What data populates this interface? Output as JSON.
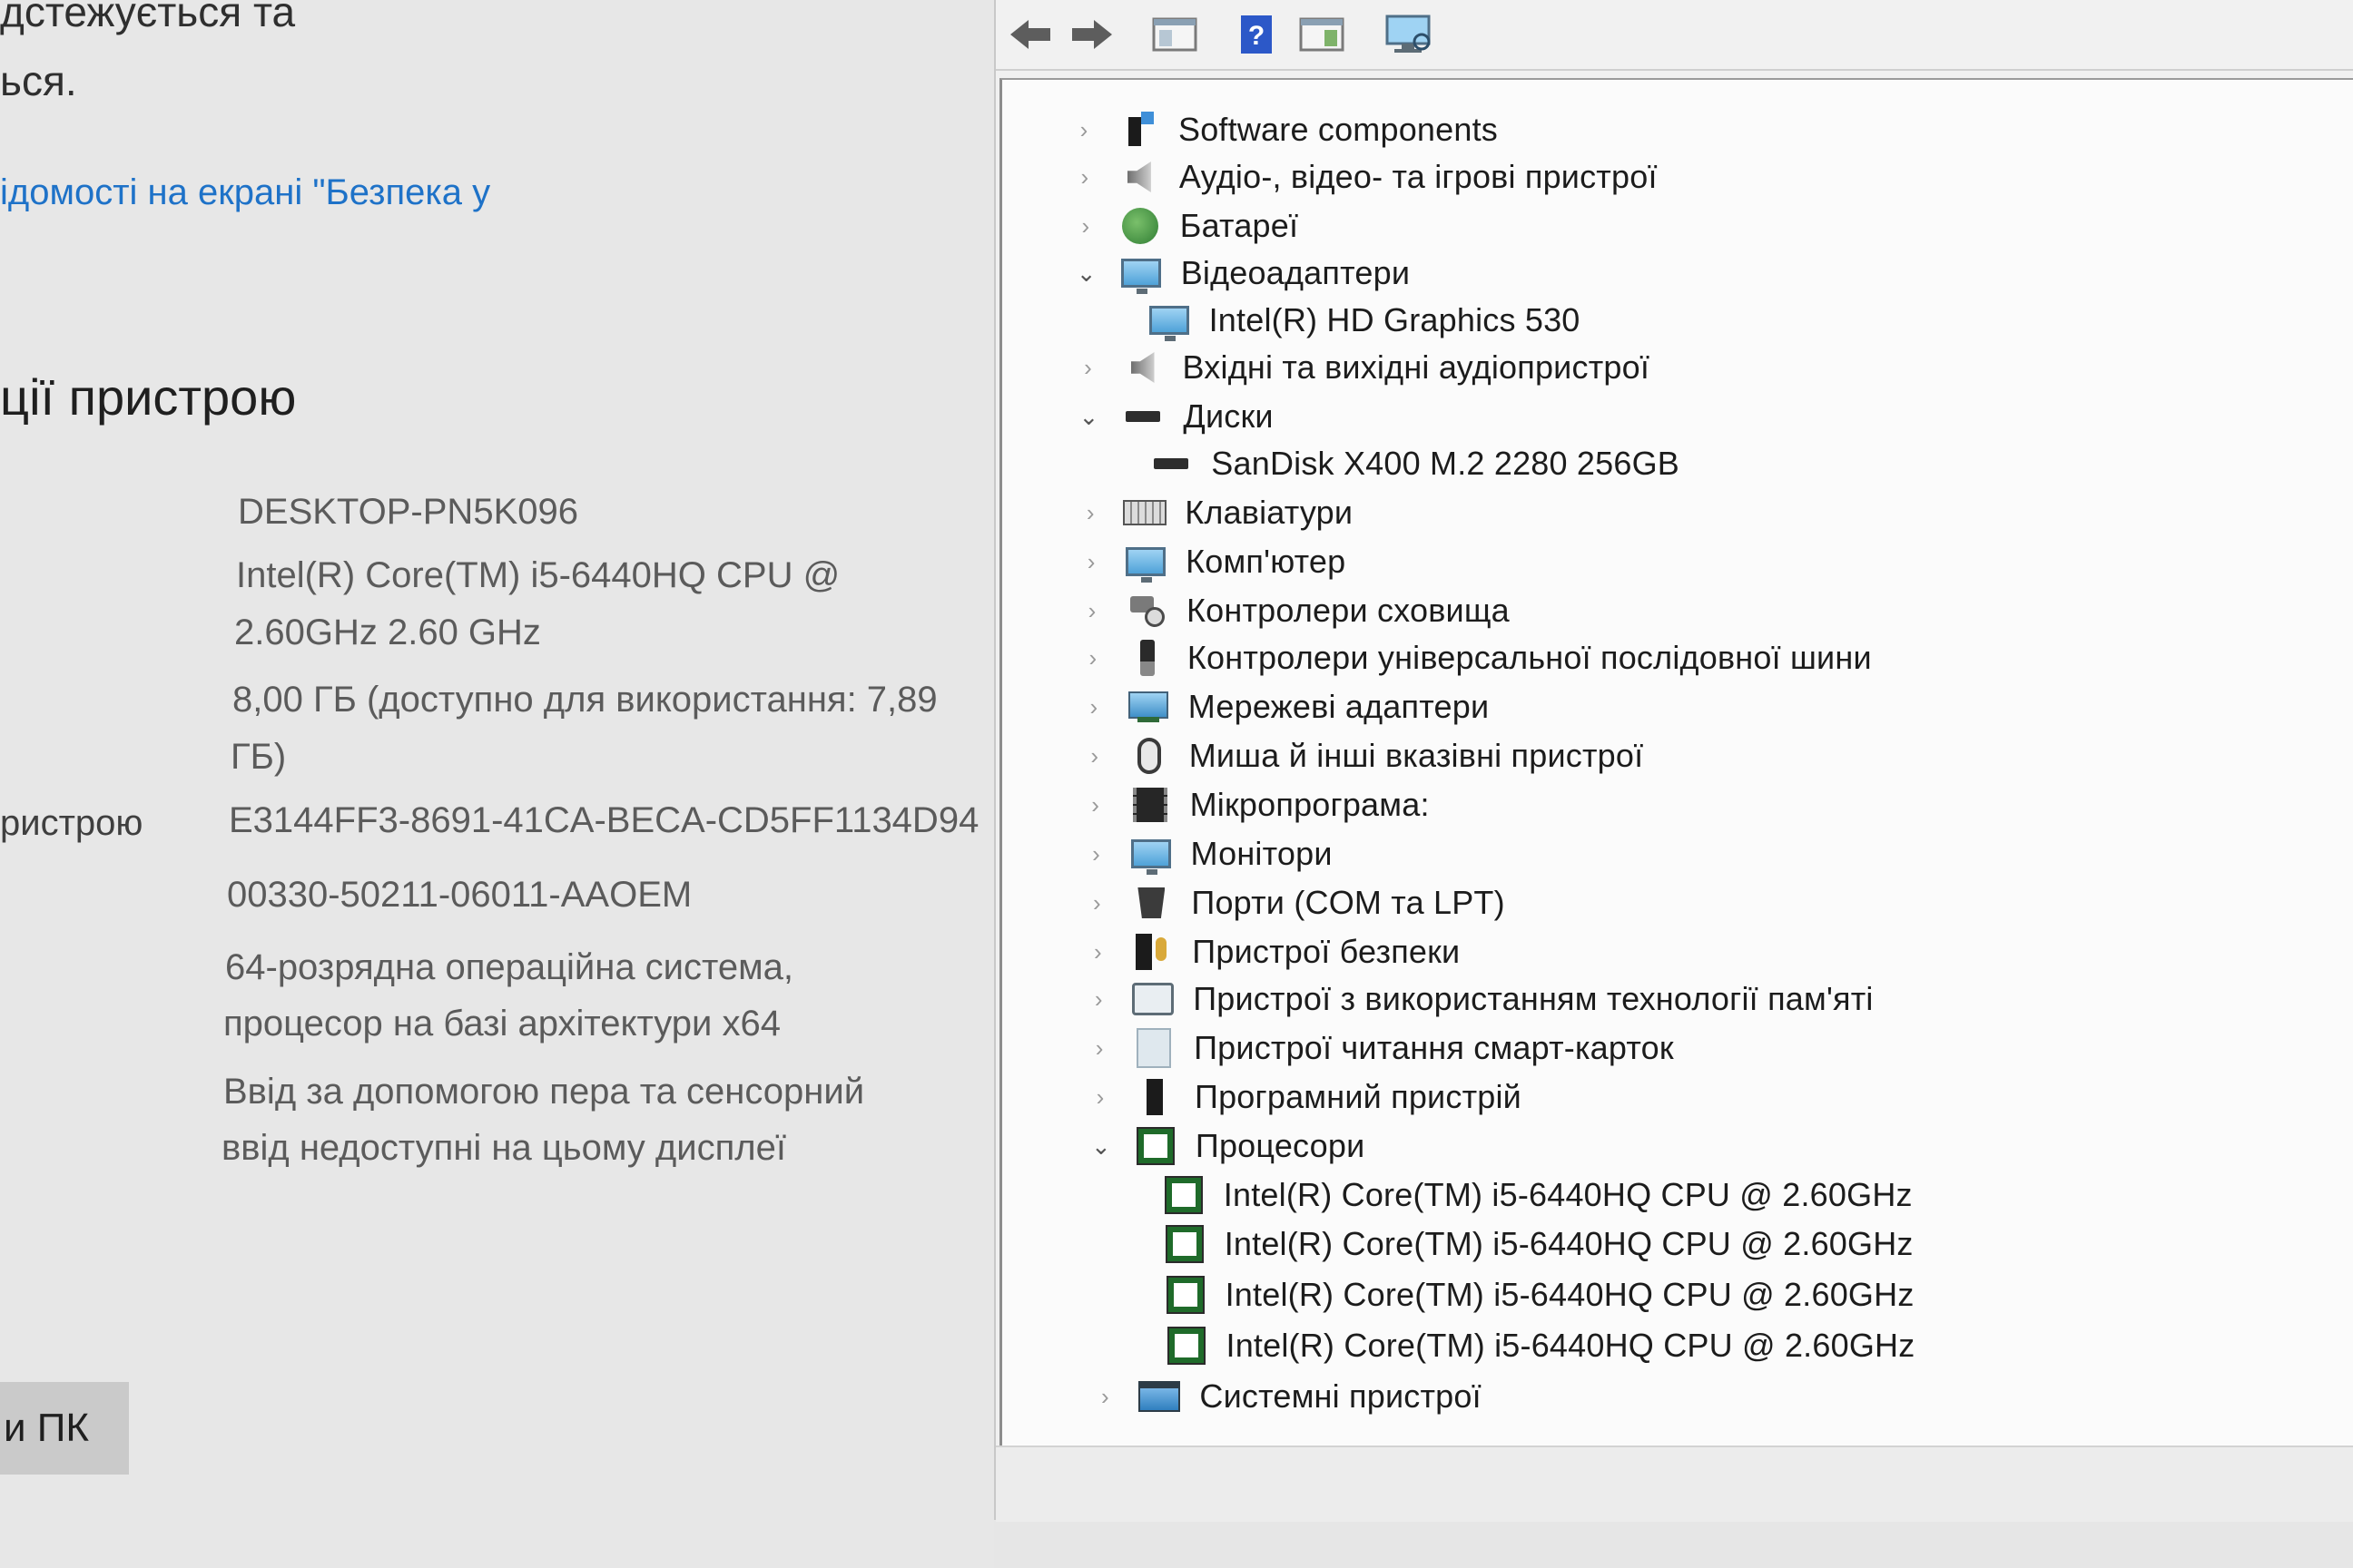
{
  "settings": {
    "partial_line_1": "дстежується та",
    "partial_line_2": "ься.",
    "link_text": "ідомості на екрані \"Безпека у",
    "section_title": "ції пристрою",
    "device_name": "DESKTOP-PN5K096",
    "processor_line1": "Intel(R) Core(TM) i5-6440HQ CPU @",
    "processor_line2": "2.60GHz   2.60 GHz",
    "ram_line1": "8,00 ГБ (доступно для використання: 7,89",
    "ram_line2": "ГБ)",
    "device_id_label": "ристрою",
    "device_id": "E3144FF3-8691-41CA-BECA-CD5FF1134D94",
    "product_id": "00330-50211-06011-AAOEM",
    "system_type_line1": "64-розрядна операційна система,",
    "system_type_line2": "процесор на базі архітектури x64",
    "pen_touch_line1": "Ввід за допомогою пера та сенсорний",
    "pen_touch_line2": "ввід недоступні на цьому дисплеї",
    "rename_button": "и ПК"
  },
  "toolbar": {
    "buttons": [
      "back-icon",
      "forward-icon",
      "console-tree-icon",
      "help-icon",
      "action-pane-icon",
      "scan-hardware-icon"
    ]
  },
  "tree": [
    {
      "label": "Software components",
      "icon": "software-icon",
      "expanded": false
    },
    {
      "label": "Аудіо-, відео- та ігрові пристрої",
      "icon": "speaker-icon",
      "expanded": false
    },
    {
      "label": "Батареї",
      "icon": "battery-icon",
      "expanded": false
    },
    {
      "label": "Відеоадаптери",
      "icon": "display-adapter-icon",
      "expanded": true
    },
    {
      "label": "Intel(R) HD Graphics 530",
      "icon": "display-adapter-icon",
      "child": true
    },
    {
      "label": "Вхідні та вихідні аудіопристрої",
      "icon": "speaker-icon",
      "expanded": false
    },
    {
      "label": "Диски",
      "icon": "disk-icon",
      "expanded": true
    },
    {
      "label": "SanDisk X400 M.2 2280 256GB",
      "icon": "disk-icon",
      "child": true
    },
    {
      "label": "Клавіатури",
      "icon": "keyboard-icon",
      "expanded": false
    },
    {
      "label": "Комп'ютер",
      "icon": "computer-icon",
      "expanded": false
    },
    {
      "label": "Контролери сховища",
      "icon": "storage-icon",
      "expanded": false
    },
    {
      "label": "Контролери універсальної послідовної шини",
      "icon": "usb-icon",
      "expanded": false
    },
    {
      "label": "Мережеві адаптери",
      "icon": "network-icon",
      "expanded": false
    },
    {
      "label": "Миша й інші вказівні пристрої",
      "icon": "mouse-icon",
      "expanded": false
    },
    {
      "label": "Мікропрограма:",
      "icon": "firmware-icon",
      "expanded": false
    },
    {
      "label": "Монітори",
      "icon": "monitor-icon",
      "expanded": false
    },
    {
      "label": "Порти (COM та LPT)",
      "icon": "port-icon",
      "expanded": false
    },
    {
      "label": "Пристрої безпеки",
      "icon": "security-icon",
      "expanded": false
    },
    {
      "label": "Пристрої з використанням технології пам'яті",
      "icon": "memory-device-icon",
      "expanded": false
    },
    {
      "label": "Пристрої читання смарт-карток",
      "icon": "smart-card-icon",
      "expanded": false
    },
    {
      "label": "Програмний пристрій",
      "icon": "software-device-icon",
      "expanded": false
    },
    {
      "label": "Процесори",
      "icon": "processor-icon",
      "expanded": true
    },
    {
      "label": "Intel(R) Core(TM) i5-6440HQ CPU @ 2.60GHz",
      "icon": "processor-icon",
      "child": true
    },
    {
      "label": "Intel(R) Core(TM) i5-6440HQ CPU @ 2.60GHz",
      "icon": "processor-icon",
      "child": true
    },
    {
      "label": "Intel(R) Core(TM) i5-6440HQ CPU @ 2.60GHz",
      "icon": "processor-icon",
      "child": true
    },
    {
      "label": "Intel(R) Core(TM) i5-6440HQ CPU @ 2.60GHz",
      "icon": "processor-icon",
      "child": true
    },
    {
      "label": "Системні пристрої",
      "icon": "system-devices-icon",
      "expanded": false
    }
  ],
  "colors": {
    "link": "#1e72c8",
    "cpu_icon": "#1f6b2a",
    "monitor_icon": "#4fa2d8"
  }
}
